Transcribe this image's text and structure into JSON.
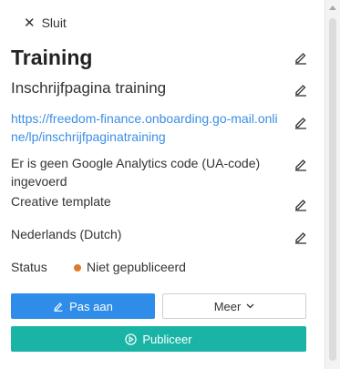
{
  "header": {
    "close_label": "Sluit",
    "close_icon": "close-icon"
  },
  "details": {
    "title": "Training",
    "subtitle": "Inschrijfpagina training",
    "url": "https://freedom-finance.onboarding.go-mail.online/lp/inschrijfpaginatraining",
    "analytics": "Er is geen Google Analytics code (UA-code) ingevoerd",
    "template": "Creative template",
    "language": "Nederlands (Dutch)"
  },
  "status": {
    "label": "Status",
    "value": "Niet gepubliceerd",
    "color": "#e07b2e"
  },
  "actions": {
    "edit_label": "Pas aan",
    "more_label": "Meer",
    "publish_label": "Publiceer"
  },
  "colors": {
    "primary": "#2f8ce8",
    "publish": "#19b4a6",
    "link": "#3a8ee6"
  }
}
